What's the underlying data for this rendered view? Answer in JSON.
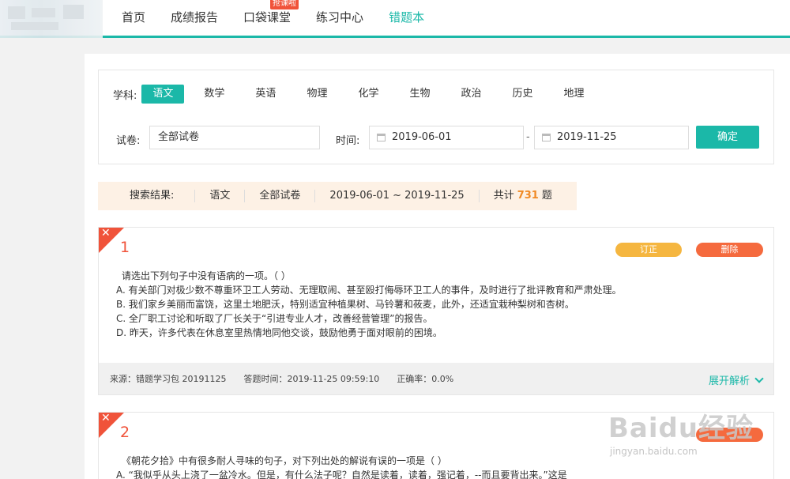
{
  "nav": {
    "items": [
      {
        "label": "首页"
      },
      {
        "label": "成绩报告"
      },
      {
        "label": "口袋课堂",
        "badge": "抢课啦"
      },
      {
        "label": "练习中心"
      },
      {
        "label": "错题本",
        "active": true
      }
    ]
  },
  "filter": {
    "subject_label": "学科:",
    "subjects": [
      "语文",
      "数学",
      "英语",
      "物理",
      "化学",
      "生物",
      "政治",
      "历史",
      "地理"
    ],
    "selected_subject": "语文",
    "paper_label": "试卷:",
    "paper_value": "全部试卷",
    "time_label": "时间:",
    "date_from": "2019-06-01",
    "date_dash": "-",
    "date_to": "2019-11-25",
    "confirm_label": "确定"
  },
  "result": {
    "label": "搜索结果:",
    "subject": "语文",
    "paper": "全部试卷",
    "range": "2019-06-01 ~ 2019-11-25",
    "total_prefix": "共计",
    "total": "731",
    "total_suffix": "题"
  },
  "questions": [
    {
      "num": "1",
      "fix_label": "订正",
      "delete_label": "删除",
      "stem": "请选出下列句子中没有语病的一项。（        ）",
      "options": [
        "A. 有关部门对极少数不尊重环卫工人劳动、无理取闹、甚至殴打侮辱环卫工人的事件，及时进行了批评教育和严肃处理。",
        "B. 我们家乡美丽而富饶，这里土地肥沃，特别适宜种植果树、马铃薯和莜麦，此外，还适宜栽种梨树和杏树。",
        "C. 全厂职工讨论和听取了厂长关于“引进专业人才，改善经营管理”的报告。",
        "D. 昨天，许多代表在休息室里热情地同他交谈，鼓励他勇于面对眼前的困境。"
      ],
      "source": "来源：错题学习包 20191125",
      "answer_time": "答题时间：2019-11-25 09:59:10",
      "accuracy": "正确率：0.0%",
      "expand_label": "展开解析"
    },
    {
      "num": "2",
      "stem": "《朝花夕拾》中有很多耐人寻味的句子，对下列出处的解说有误的一项是（        ）",
      "options": [
        "A. “我似乎从头上浇了一盆冷水。但是，有什么法子呢？自然是读着，读着，强记着，--而且要背出来。”这是"
      ]
    }
  ],
  "watermark": {
    "main": "Baidu经验",
    "sub": "jingyan.baidu.com"
  }
}
